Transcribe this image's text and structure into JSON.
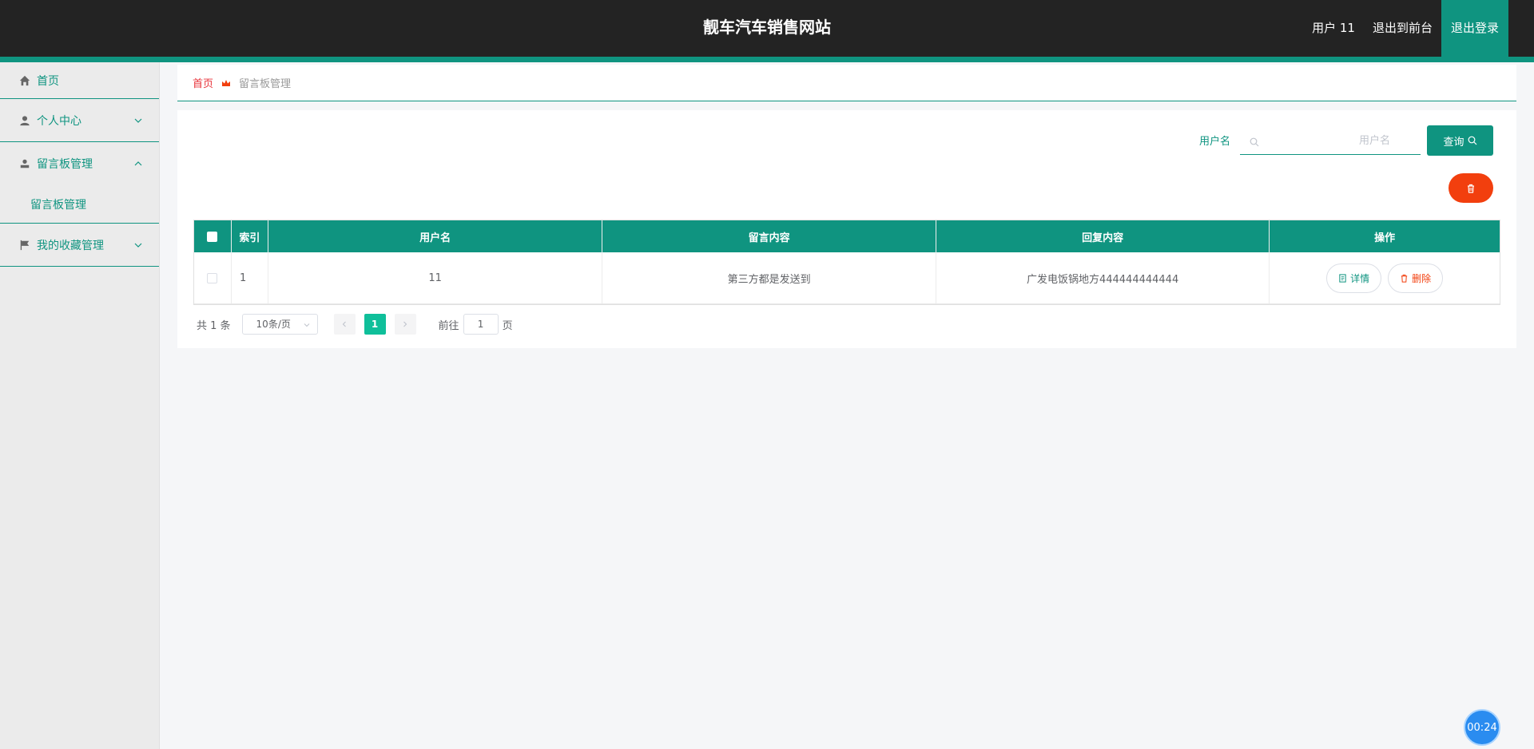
{
  "header": {
    "site_title": "靓车汽车销售网站",
    "user_label": "用户 11",
    "back_to_front": "退出到前台",
    "logout": "退出登录"
  },
  "sidebar": {
    "items": [
      {
        "label": "首页",
        "icon": "home-icon"
      },
      {
        "label": "个人中心",
        "icon": "user-icon"
      },
      {
        "label": "留言板管理",
        "icon": "message-board-icon",
        "expanded": true,
        "children": [
          {
            "label": "留言板管理"
          }
        ]
      },
      {
        "label": "我的收藏管理",
        "icon": "flag-icon"
      }
    ]
  },
  "breadcrumb": {
    "home": "首页",
    "current": "留言板管理"
  },
  "search": {
    "label": "用户名",
    "placeholder": "用户名",
    "value": "",
    "query_button": "查询"
  },
  "table": {
    "columns": [
      "索引",
      "用户名",
      "留言内容",
      "回复内容",
      "操作"
    ],
    "rows": [
      {
        "index": "1",
        "username": "11",
        "content": "第三方都是发送到",
        "reply": "广发电饭锅地方444444444444",
        "detail_label": "详情",
        "delete_label": "删除"
      }
    ]
  },
  "pagination": {
    "total": "共 1 条",
    "page_size": "10条/页",
    "current_page": "1",
    "goto_prefix": "前往",
    "goto_value": "1",
    "goto_suffix": "页"
  },
  "timer": {
    "text": "00:24"
  },
  "colors": {
    "primary": "#0f9480",
    "danger": "#f23f0e",
    "header_bg": "#232323",
    "page_active": "#0fbf9a"
  }
}
